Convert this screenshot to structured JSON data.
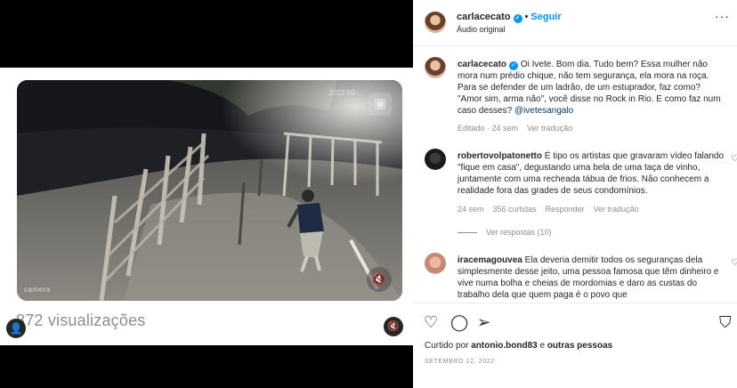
{
  "media": {
    "views": "872 visualizações",
    "camera_label": "camera",
    "camera_time": "2022-09-..."
  },
  "post": {
    "username": "carlacecato",
    "verified_mark": "✓",
    "follow": "Seguir",
    "separator": "•",
    "audio": "Áudio original",
    "more": "···"
  },
  "caption": {
    "username": "carlacecato",
    "text": "Oi Ivete. Bom dia. Tudo bem? Essa mulher não mora num prédio chique, não tem segurança, ela mora na roça. Para se defender de um ladrão, de um estuprador, faz como? \"Amor sim, arma não\", você disse no Rock in Rio. E como faz num caso desses?",
    "mention": "@ivetesangalo",
    "edited": "Editado · 24 sem",
    "translate": "Ver tradução"
  },
  "comments": [
    {
      "username": "robertovolpatonetto",
      "text": "É tipo os artistas que gravaram vídeo falando \"fique em casa\", degustando uma bela de uma taça de vinho, juntamente com uma recheada tábua de frios. Não conhecem a realidade fora das grades de seus condomínios.",
      "time": "24 sem",
      "likes": "356 curtidas",
      "reply": "Responder",
      "translate": "Ver tradução",
      "view_replies": "Ver respostas (10)"
    },
    {
      "username": "iracemagouvea",
      "text": "Ela deveria demitir todos os seguranças dela simplesmente desse jeito, uma pessoa famosa que têm dinheiro e vive numa bolha e cheias de mordomias e daro as custas do trabalho dela que quem paga é o povo que"
    }
  ],
  "footer": {
    "liked_prefix": "Curtido por",
    "liked_user": "antonio.bond83",
    "liked_and": "e",
    "liked_others": "outras pessoas",
    "date": "SETEMBRO 12, 2022"
  },
  "icons": {
    "heart": "♡",
    "comment": "◯",
    "share": "➢",
    "save": "⛉",
    "mute": "🔇",
    "person": "👤",
    "camera_overlay": "▣"
  },
  "colors": {
    "link_blue": "#0095f6",
    "muted_gray": "#8e8e8e",
    "text": "#262626"
  }
}
